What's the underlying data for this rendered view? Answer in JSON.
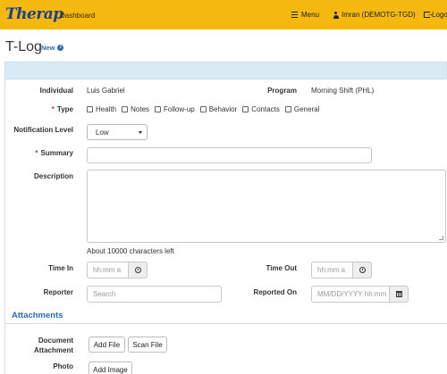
{
  "header": {
    "logo_text": "Therap",
    "dashboard_label": "Dashboard",
    "menu_label": "Menu",
    "user_label": "Imran (DEMOTG-TGD)",
    "logout_label": "Logo",
    "bar_color": "#f5b80f"
  },
  "page": {
    "title": "T-Log",
    "badge": "New"
  },
  "form": {
    "individual_label": "Individual",
    "individual_value": "Luis Gabriel",
    "program_label": "Program",
    "program_value": "Morning Shift (PHL)",
    "type_label": "Type",
    "type_options": [
      "Health",
      "Notes",
      "Follow-up",
      "Behavior",
      "Contacts",
      "General"
    ],
    "notification_label": "Notification Level",
    "notification_value": "Low",
    "summary_label": "Summary",
    "summary_value": "",
    "description_label": "Description",
    "description_value": "",
    "char_hint": "About 10000 characters left",
    "time_in_label": "Time In",
    "time_in_placeholder": "hh:mm a",
    "time_out_label": "Time Out",
    "time_out_placeholder": "hh:mm a",
    "reporter_label": "Reporter",
    "reporter_placeholder": "Search",
    "reported_on_label": "Reported On",
    "reported_on_placeholder": "MM/DD/YYYY hh:mm"
  },
  "attachments": {
    "section_title": "Attachments",
    "document_label": "Document Attachment",
    "add_file_label": "Add File",
    "scan_file_label": "Scan File",
    "photo_label": "Photo",
    "add_image_label": "Add Image"
  }
}
